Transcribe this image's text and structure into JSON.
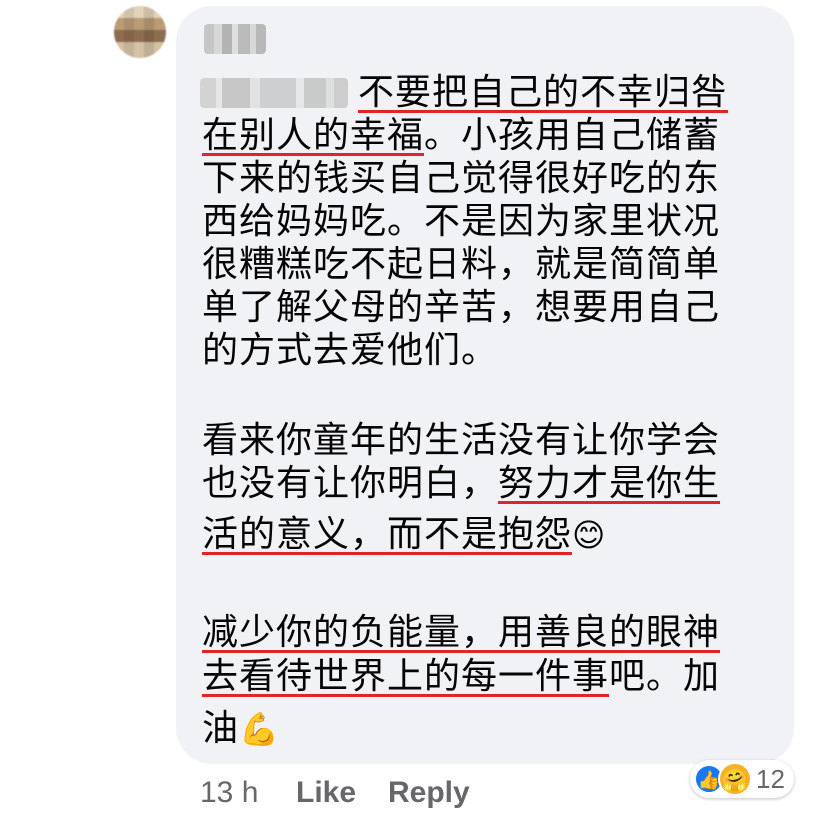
{
  "comment": {
    "time": "13 h",
    "like_label": "Like",
    "reply_label": "Reply",
    "reaction_count": "12",
    "lines": [
      {
        "plain": "",
        "hl": "不要把自己的不幸归咎",
        "tail": ""
      },
      {
        "plain": "",
        "hl": "在别人的幸福",
        "tail": "。小孩用自己储蓄"
      },
      {
        "plain": "下来的钱买自己觉得很好吃的东",
        "hl": "",
        "tail": ""
      },
      {
        "plain": "西给妈妈吃。不是因为家里状况",
        "hl": "",
        "tail": ""
      },
      {
        "plain": "很糟糕吃不起日料，就是简简单",
        "hl": "",
        "tail": ""
      },
      {
        "plain": "单了解父母的辛苦，想要用自己",
        "hl": "",
        "tail": ""
      },
      {
        "plain": "的方式去爱他们。",
        "hl": "",
        "tail": ""
      },
      {
        "plain": "看来你童年的生活没有让你学会",
        "hl": "",
        "tail": ""
      },
      {
        "plain": "也没有让你明白，",
        "hl": "努力才是你生",
        "tail": ""
      },
      {
        "plain": "",
        "hl": "活的意义，而不是抱怨",
        "tail": "",
        "emoji": "😊"
      },
      {
        "plain": "",
        "hl": "减少你的负能量，用善良的眼神",
        "tail": ""
      },
      {
        "plain": "",
        "hl": "去看待世界上的每一件事",
        "tail": "吧。加"
      },
      {
        "plain": "油",
        "hl": "",
        "tail": "",
        "emoji": "💪"
      }
    ]
  },
  "colors": {
    "highlight_underline": "#e0242b",
    "bubble": "#f0f2f5",
    "like_blue": "#1877f2"
  }
}
